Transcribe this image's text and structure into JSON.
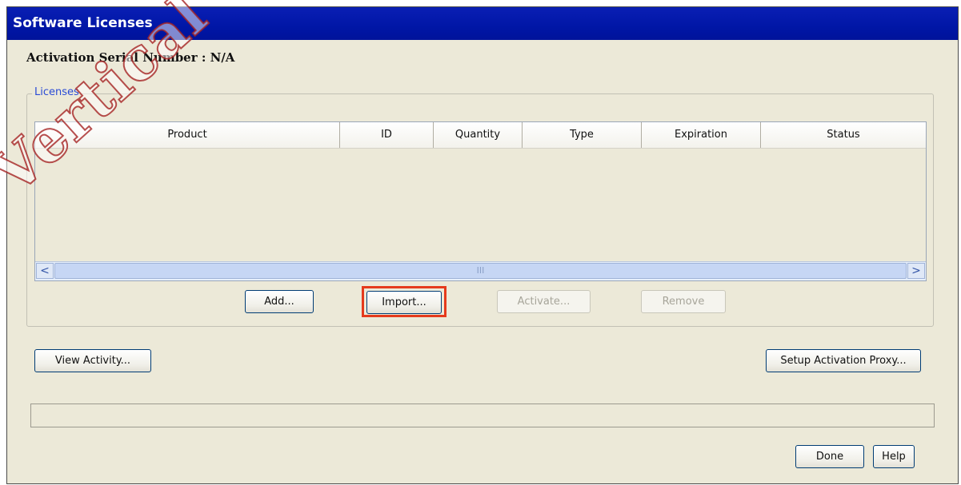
{
  "window": {
    "title": "Software Licenses"
  },
  "activation": {
    "serial_label": "Activation Serial Number : N/A"
  },
  "licenses": {
    "group_label": "Licenses",
    "columns": [
      "Product",
      "ID",
      "Quantity",
      "Type",
      "Expiration",
      "Status"
    ],
    "rows": []
  },
  "scrollbar": {
    "left_arrow": "<",
    "right_arrow": ">",
    "thumb_grip": "III"
  },
  "buttons": {
    "add": "Add...",
    "import": "Import...",
    "activate": "Activate...",
    "remove": "Remove",
    "view_activity": "View Activity...",
    "setup_proxy": "Setup Activation Proxy...",
    "done": "Done",
    "help": "Help"
  },
  "status_text": "",
  "watermark": "Vertical Wave IP KI",
  "colors": {
    "title_bar": "#0016a6",
    "dialog_background": "#ece9d8",
    "highlight_box": "#e53a1c",
    "group_label": "#2a4bd6"
  }
}
